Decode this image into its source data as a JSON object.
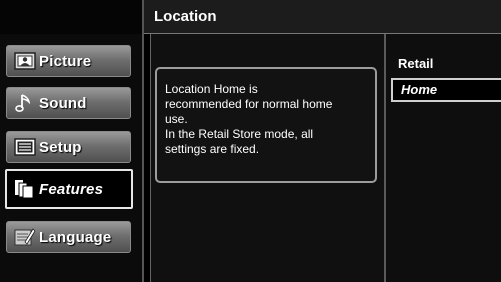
{
  "header": {
    "title": "Location"
  },
  "sidebar": {
    "items": [
      {
        "label": "Picture",
        "icon": "picture-icon",
        "active": false
      },
      {
        "label": "Sound",
        "icon": "music-note-icon",
        "active": false
      },
      {
        "label": "Setup",
        "icon": "setup-icon",
        "active": false
      },
      {
        "label": "Features",
        "icon": "features-icon",
        "active": true
      },
      {
        "label": "Language",
        "icon": "language-icon",
        "active": false
      }
    ]
  },
  "help": {
    "lines": [
      "Location Home is",
      "recommended for normal home",
      "use.",
      "In the Retail Store mode, all",
      "settings are fixed."
    ]
  },
  "options": {
    "items": [
      {
        "label": "Retail",
        "selected": false
      },
      {
        "label": "Home",
        "selected": true
      }
    ]
  },
  "colors": {
    "background": "#000000",
    "button": "#6f6f6f",
    "border": "#9c9c9c"
  }
}
